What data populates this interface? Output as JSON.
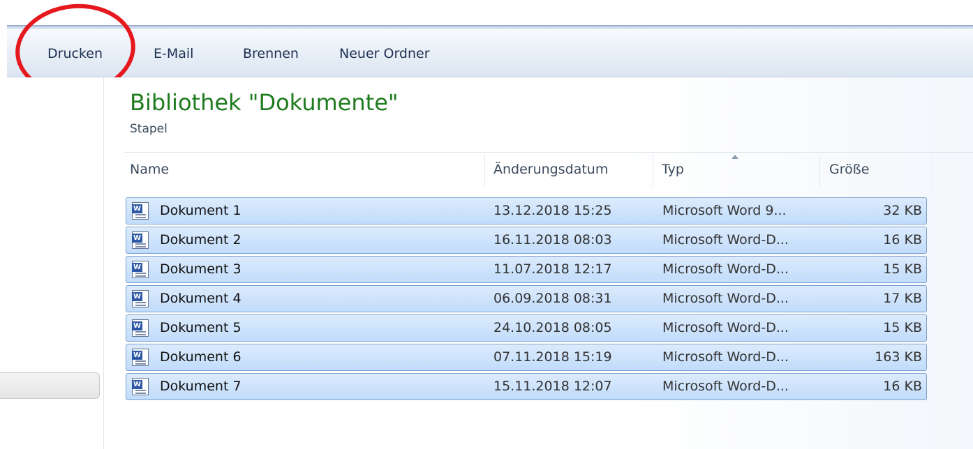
{
  "toolbar": {
    "buttons": [
      {
        "label": "Drucken"
      },
      {
        "label": "E-Mail"
      },
      {
        "label": "Brennen"
      },
      {
        "label": "Neuer Ordner"
      }
    ]
  },
  "library": {
    "title": "Bibliothek \"Dokumente\"",
    "subtitle": "Stapel"
  },
  "columns": {
    "name": "Name",
    "date": "Änderungsdatum",
    "type": "Typ",
    "size": "Größe"
  },
  "files": [
    {
      "name": "Dokument 1",
      "date": "13.12.2018 15:25",
      "type": "Microsoft Word 9...",
      "size": "32 KB",
      "icon": "word-doc-icon"
    },
    {
      "name": "Dokument 2",
      "date": "16.11.2018 08:03",
      "type": "Microsoft Word-D...",
      "size": "16 KB",
      "icon": "word-doc-icon"
    },
    {
      "name": "Dokument 3",
      "date": "11.07.2018 12:17",
      "type": "Microsoft Word-D...",
      "size": "15 KB",
      "icon": "word-doc-icon"
    },
    {
      "name": "Dokument 4",
      "date": "06.09.2018 08:31",
      "type": "Microsoft Word-D...",
      "size": "17 KB",
      "icon": "word-doc-icon"
    },
    {
      "name": "Dokument 5",
      "date": "24.10.2018 08:05",
      "type": "Microsoft Word-D...",
      "size": "15 KB",
      "icon": "word-doc-icon"
    },
    {
      "name": "Dokument 6",
      "date": "07.11.2018 15:19",
      "type": "Microsoft Word-D...",
      "size": "163 KB",
      "icon": "word-doc-icon"
    },
    {
      "name": "Dokument 7",
      "date": "15.11.2018 12:07",
      "type": "Microsoft Word-D...",
      "size": "16 KB",
      "icon": "word-doc-icon"
    }
  ],
  "colors": {
    "title_green": "#1e7b1e",
    "highlight_red": "#e5181e",
    "selection_blue": "#c1dcfb"
  }
}
